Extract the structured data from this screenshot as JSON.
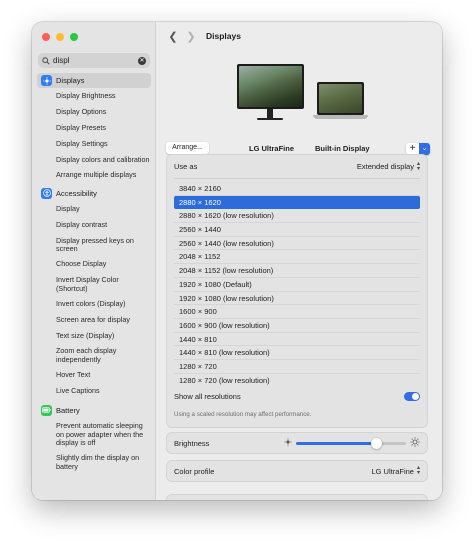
{
  "window": {
    "title": "Displays"
  },
  "search": {
    "value": "displ"
  },
  "sidebar": {
    "sections": [
      {
        "label": "Displays",
        "icon": "sun-icon",
        "color": "#2f7cf6",
        "items": [
          "Display Brightness",
          "Display Options",
          "Display Presets",
          "Display Settings",
          "Display colors and calibration",
          "Arrange multiple displays"
        ]
      },
      {
        "label": "Accessibility",
        "icon": "accessibility-icon",
        "color": "#2f7cf6",
        "items": [
          "Display",
          "Display contrast",
          "Display pressed keys on screen",
          "Choose Display",
          "Invert Display Color (Shortcut)",
          "Invert colors (Display)",
          "Screen area for display",
          "Text size (Display)",
          "Zoom each display independently",
          "Hover Text",
          "Live Captions"
        ]
      },
      {
        "label": "Battery",
        "icon": "battery-icon",
        "color": "#34c759",
        "items": [
          "Prevent automatic sleeping on power adapter when the display is off",
          "Slightly dim the display on battery"
        ]
      }
    ]
  },
  "arrangement": {
    "arrange_label": "Arrange...",
    "monitors": [
      "LG UltraFine",
      "Built-in Display"
    ],
    "add_label": "+"
  },
  "settings": {
    "use_as_label": "Use as",
    "use_as_value": "Extended display",
    "resolutions": [
      "3840 × 2160",
      "2880 × 1620",
      "2880 × 1620 (low resolution)",
      "2560 × 1440",
      "2560 × 1440 (low resolution)",
      "2048 × 1152",
      "2048 × 1152 (low resolution)",
      "1920 × 1080 (Default)",
      "1920 × 1080 (low resolution)",
      "1600 × 900",
      "1600 × 900 (low resolution)",
      "1440 × 810",
      "1440 × 810 (low resolution)",
      "1280 × 720",
      "1280 × 720 (low resolution)"
    ],
    "selected_resolution": "2880 × 1620",
    "show_all_label": "Show all resolutions",
    "show_all_on": true,
    "note": "Using a scaled resolution may affect performance.",
    "brightness_label": "Brightness",
    "brightness_level": 0.73,
    "color_profile_label": "Color profile",
    "color_profile_value": "LG UltraFine"
  },
  "accent_color": "#2f6ee3"
}
